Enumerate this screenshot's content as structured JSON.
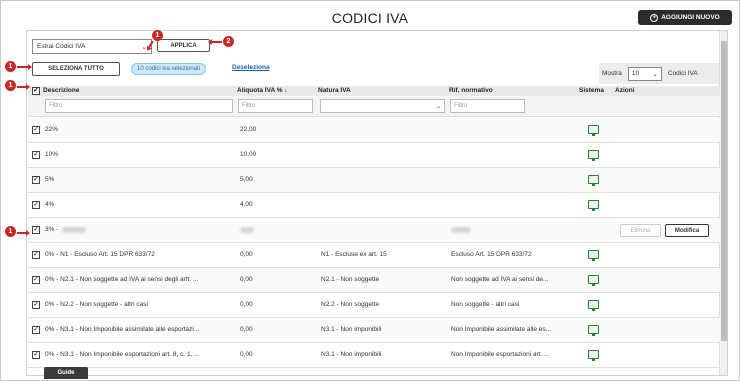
{
  "header": {
    "title": "CODICI IVA",
    "add_button": "AGGIUNGI NUOVO"
  },
  "toolbar": {
    "extract_select": "Estrai Codici IVA",
    "apply_button": "APPLICA",
    "select_all_button": "SELEZIONA TUTTO",
    "selected_badge": "10 codici iva selezionati",
    "deselect_link": "Deseleziona"
  },
  "pagination": {
    "show_label": "Mostra",
    "page_size": "10",
    "unit_label": "Codici IVA"
  },
  "table": {
    "columns": [
      "Descrizione",
      "Aliquota IVA % ↓",
      "Natura IVA",
      "Rif. normativo",
      "Sistema",
      "Azioni"
    ],
    "filter_placeholder": "Filtro",
    "rows": [
      {
        "desc": "22%",
        "rate": "22,00",
        "nature": "",
        "ref": "",
        "checked": true,
        "system": true
      },
      {
        "desc": "10%",
        "rate": "10,00",
        "nature": "",
        "ref": "",
        "checked": true,
        "system": true
      },
      {
        "desc": "5%",
        "rate": "5,00",
        "nature": "",
        "ref": "",
        "checked": true,
        "system": true
      },
      {
        "desc": "4%",
        "rate": "4,00",
        "nature": "",
        "ref": "",
        "checked": true,
        "system": true
      },
      {
        "desc": "3% -",
        "rate": "",
        "nature": "",
        "ref": "",
        "checked": true,
        "system": false,
        "blurred": true
      },
      {
        "desc": "0% - N1 - Escluso Art. 15 DPR 633/72",
        "rate": "0,00",
        "nature": "N1 - Escluse ex art. 15",
        "ref": "Escluso Art. 15 DPR 633/72",
        "checked": true,
        "system": true
      },
      {
        "desc": "0% - N2.1 - Non soggette ad IVA ai sensi degli artt. ...",
        "rate": "0,00",
        "nature": "N2.1 - Non soggette",
        "ref": "Non soggette ad IVA ai sensi de...",
        "checked": true,
        "system": true
      },
      {
        "desc": "0% - N2.2 - Non soggette - altri casi",
        "rate": "0,00",
        "nature": "N2.2 - Non soggette",
        "ref": "Non soggette - altri casi",
        "checked": true,
        "system": true
      },
      {
        "desc": "0% - N3.1 - Non Imponibile assimilate alle esportazi...",
        "rate": "0,00",
        "nature": "N3.1 - Non imponibili",
        "ref": "Non Imponibile assimilate alle es...",
        "checked": true,
        "system": true
      },
      {
        "desc": "0% - N3.1 - Non Imponibile esportazioni art. 8, c. 1, ...",
        "rate": "0,00",
        "nature": "N3.1 - Non imponibili",
        "ref": "Non Imponibile esportazioni art. ...",
        "checked": true,
        "system": true
      }
    ],
    "row_actions": {
      "delete": "Elimina",
      "edit": "Modifica"
    }
  },
  "footer": {
    "guide_tab": "Guide"
  },
  "annotations": {
    "marker_1": "1",
    "marker_2": "2"
  },
  "colors": {
    "accent": "#c62828",
    "badge_bg": "#cfe8f8",
    "link": "#1a5fb4",
    "system_icon": "#2e7d32"
  }
}
